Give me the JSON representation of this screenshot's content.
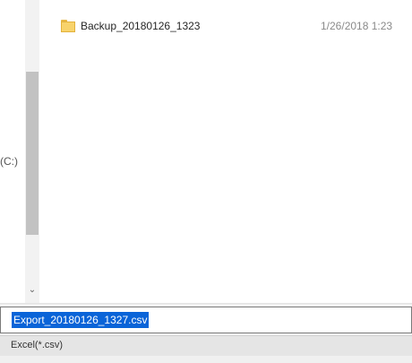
{
  "file_list": {
    "items": [
      {
        "name": "Backup_20180126_1323",
        "date": "1/26/2018 1:23",
        "icon": "folder-icon"
      }
    ]
  },
  "sidebar": {
    "edge_text": "(C:)"
  },
  "save_form": {
    "filename_value": "Export_20180126_1327.csv",
    "file_type": "Excel(*.csv)"
  },
  "colors": {
    "selection": "#0a64d8",
    "folder": "#f8d36b"
  }
}
